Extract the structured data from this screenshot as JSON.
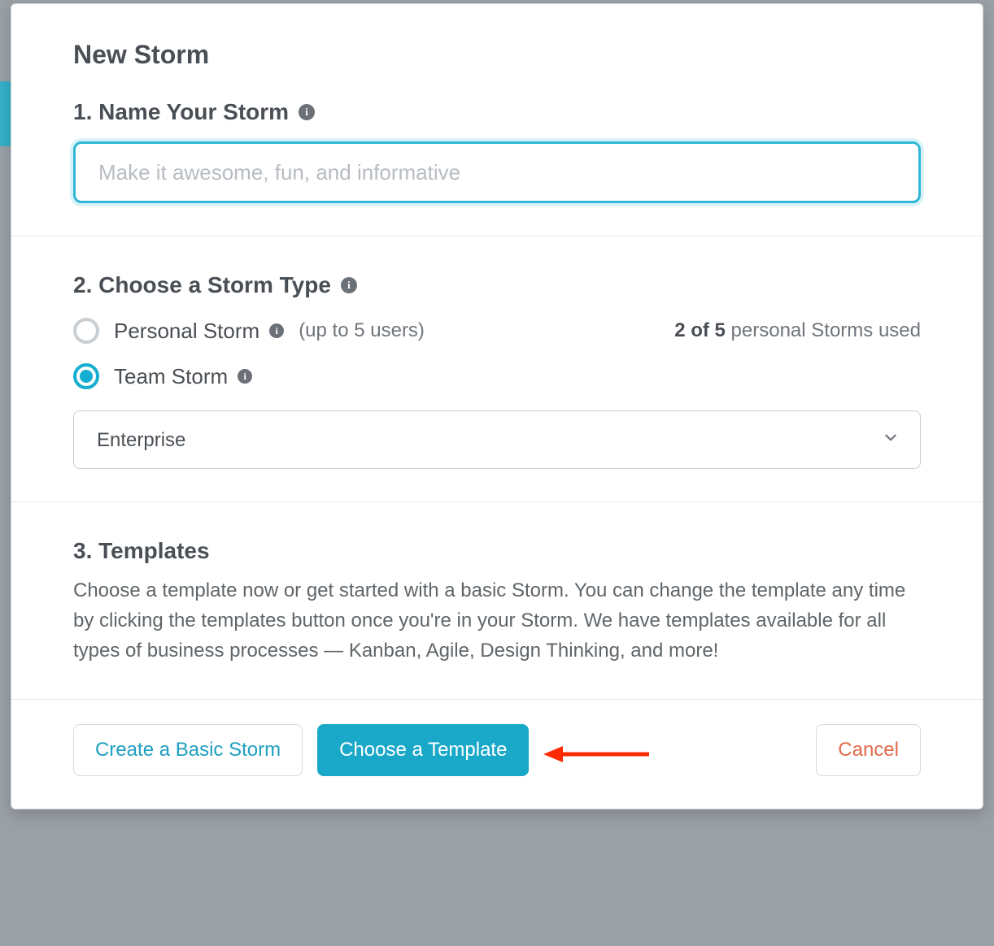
{
  "modal": {
    "title": "New Storm"
  },
  "step1": {
    "title": "1. Name Your Storm",
    "placeholder": "Make it awesome, fun, and informative",
    "value": ""
  },
  "step2": {
    "title": "2. Choose a Storm Type",
    "personal": {
      "label": "Personal Storm",
      "sub": "(up to 5 users)",
      "selected": false
    },
    "usage": {
      "used": "2",
      "total": "5",
      "text_prefix_bold": "2 of 5",
      "text_suffix": " personal Storms used"
    },
    "team": {
      "label": "Team Storm",
      "selected": true,
      "select_value": "Enterprise"
    }
  },
  "step3": {
    "title": "3. Templates",
    "desc": "Choose a template now or get started with a basic Storm. You can change the template any time by clicking the templates button once you're in your Storm. We have templates available for all types of business processes — Kanban, Agile, Design Thinking, and more!"
  },
  "footer": {
    "create_basic": "Create a Basic Storm",
    "choose_template": "Choose a Template",
    "cancel": "Cancel"
  },
  "icons": {
    "info_glyph": "i"
  }
}
